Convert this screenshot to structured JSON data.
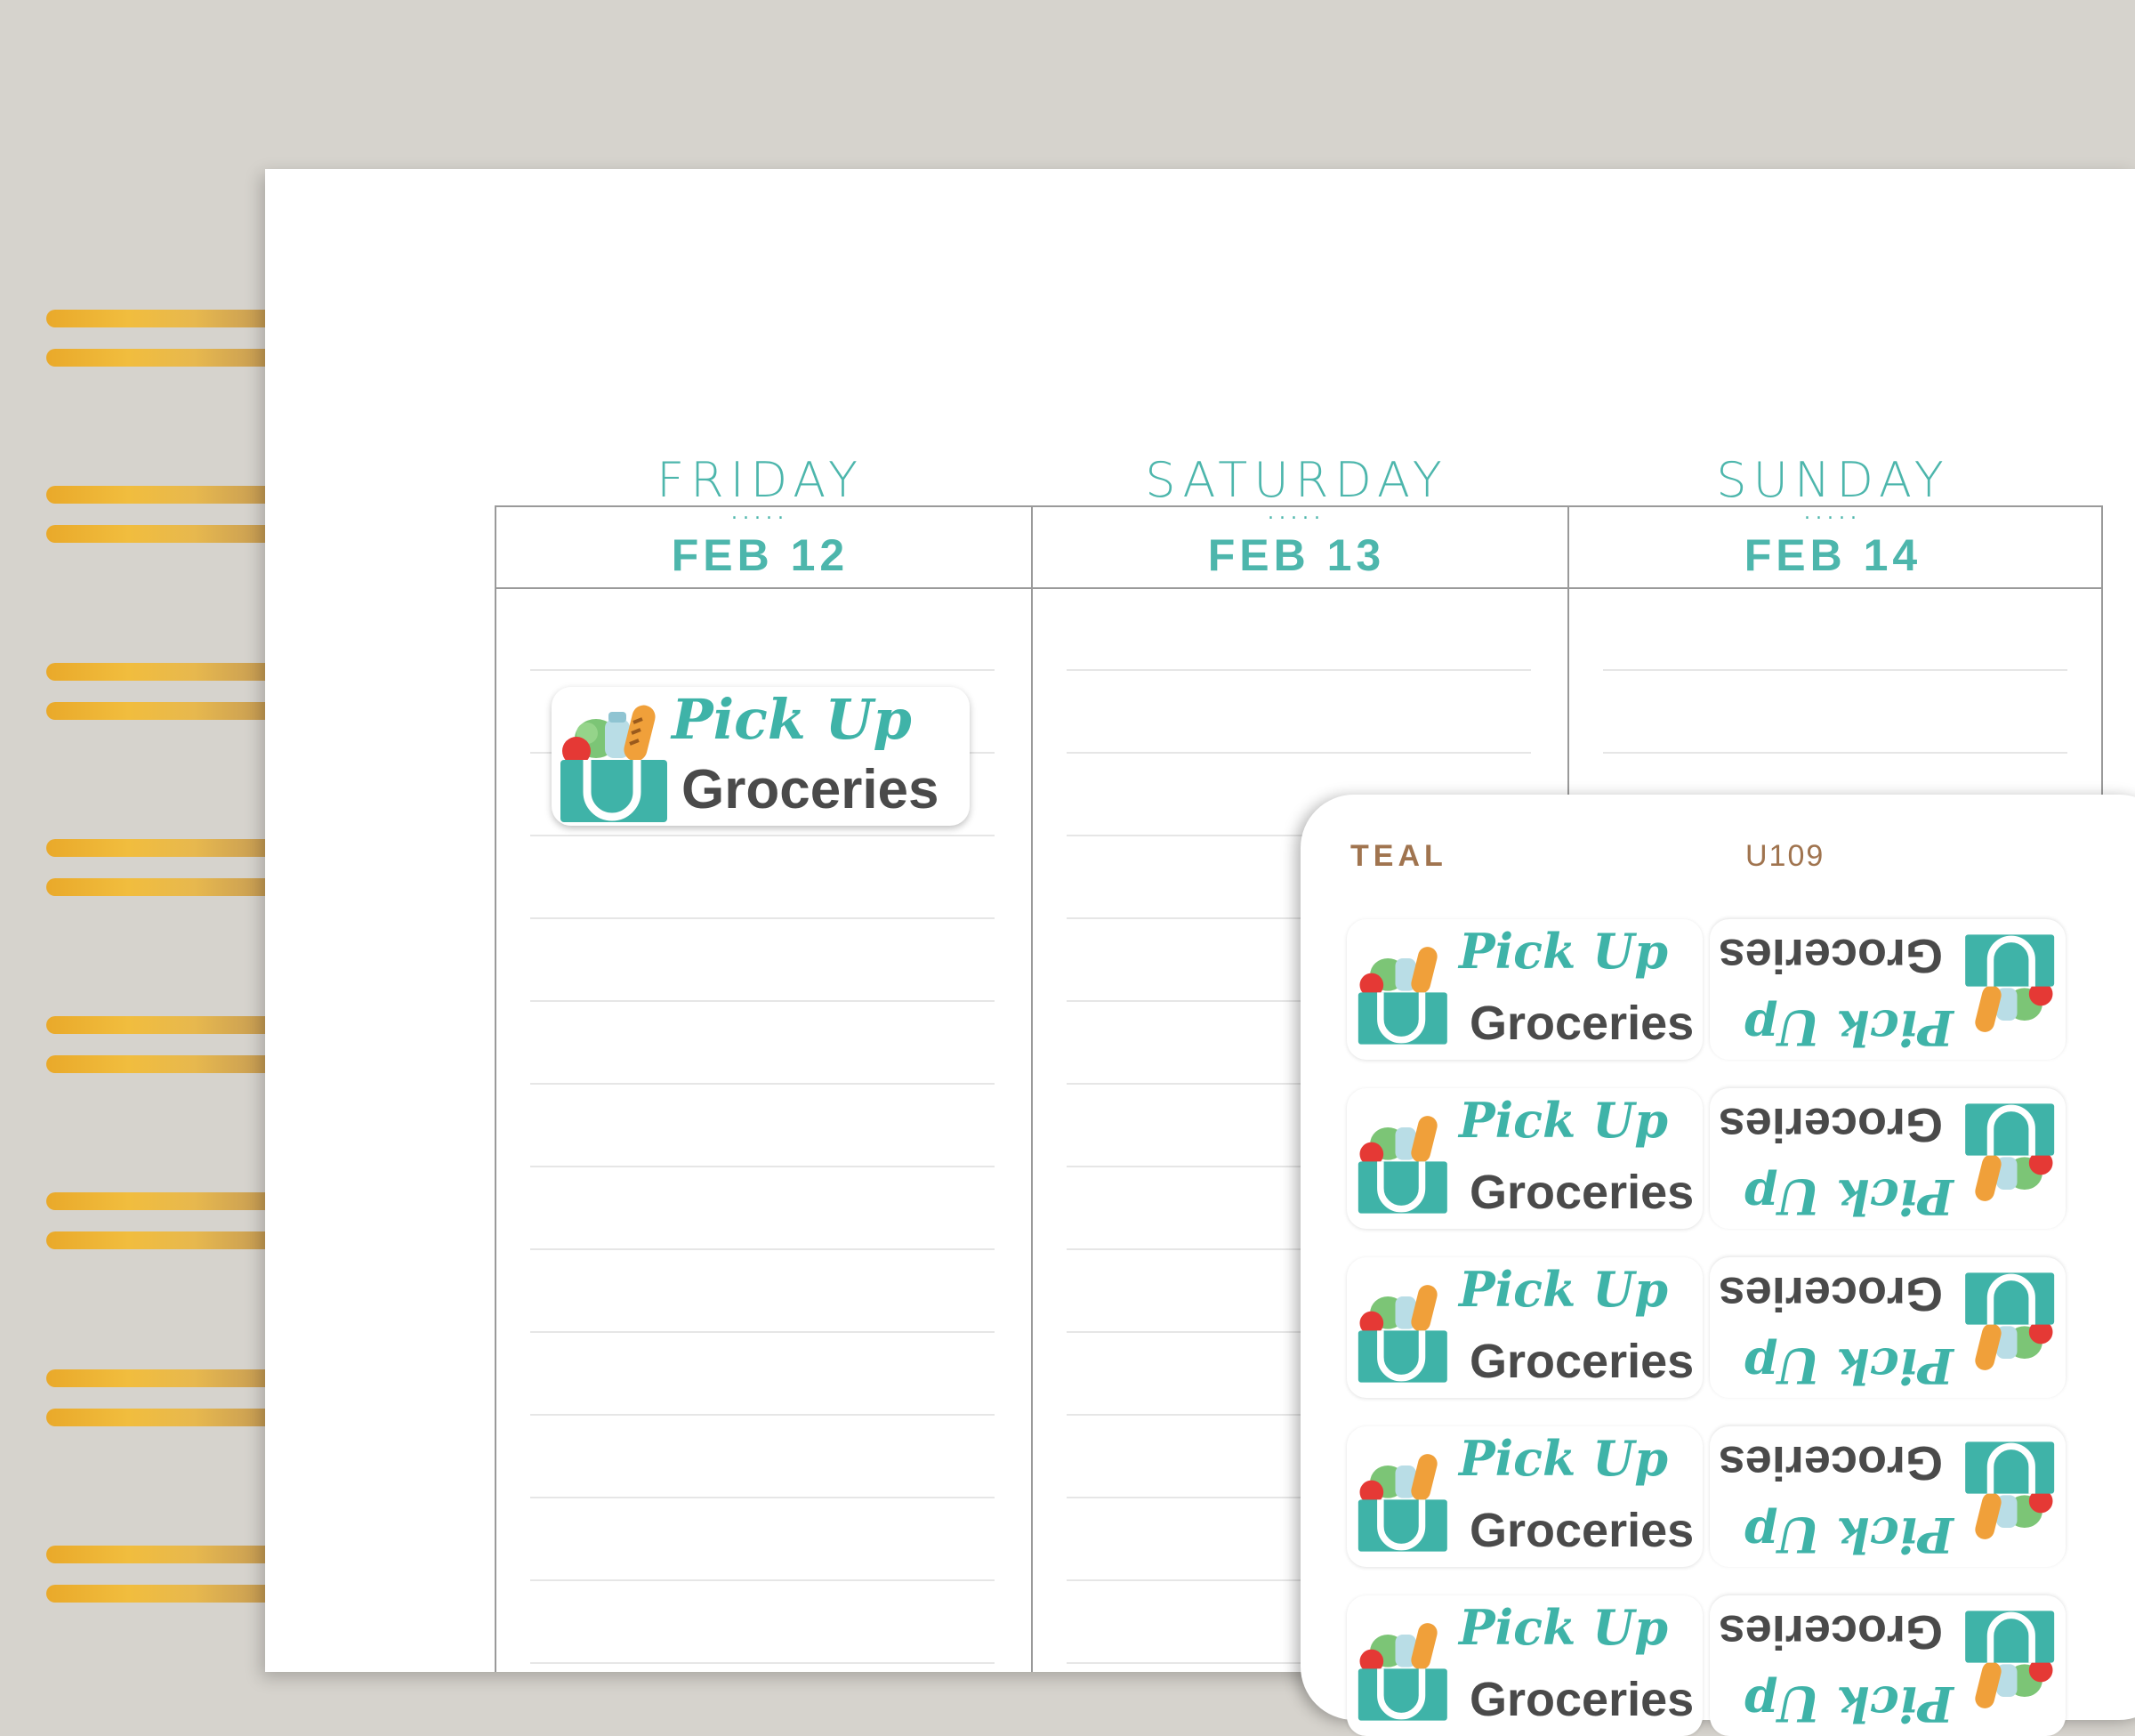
{
  "planner": {
    "days": [
      {
        "name": "FRIDAY",
        "dots": ".....",
        "date": "FEB 12"
      },
      {
        "name": "SATURDAY",
        "dots": ".....",
        "date": "FEB 13"
      },
      {
        "name": "SUNDAY",
        "dots": ".....",
        "date": "FEB 14"
      }
    ]
  },
  "sticker": {
    "line1": "Pick Up",
    "line2": "Groceries",
    "icon": "grocery-bag-icon"
  },
  "sheet": {
    "color_label": "TEAL",
    "code": "U109"
  },
  "colors": {
    "teal": "#4db6ac",
    "dark_text": "#4a4a4a",
    "gold_ring": "#f1bd3e",
    "background": "#d6d3cd"
  }
}
